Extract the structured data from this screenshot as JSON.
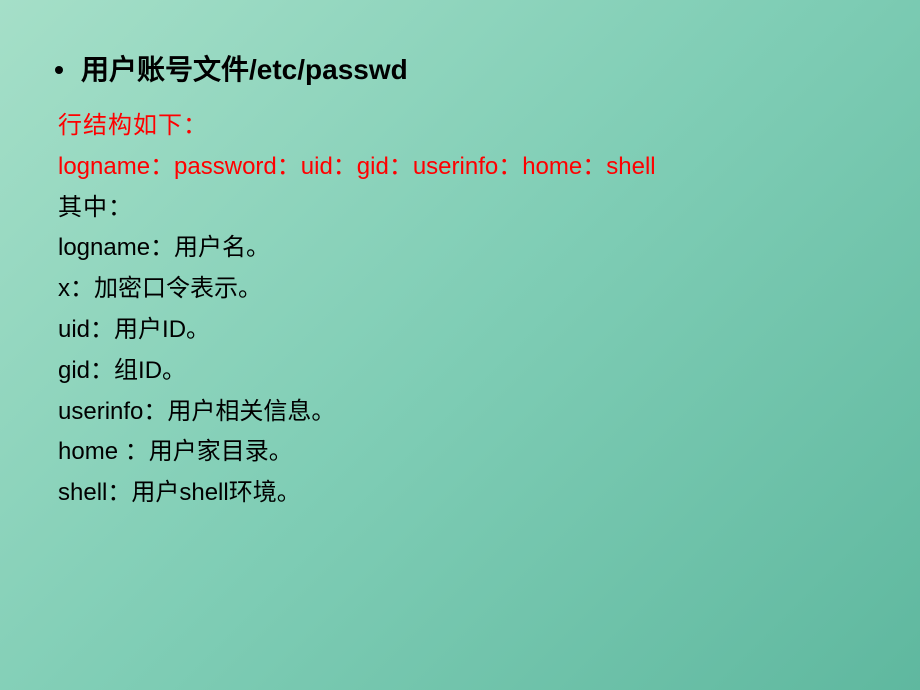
{
  "heading": "用户账号文件/etc/passwd",
  "structure_label": "行结构如下：",
  "format_line": "logname：password：uid：gid：userinfo：home：shell",
  "where_label": "其中：",
  "fields": [
    "logname：用户名。",
    "x：加密口令表示。",
    "uid：用户ID。",
    "gid：组ID。",
    "userinfo：用户相关信息。",
    "home ：用户家目录。",
    "shell：用户shell环境。"
  ]
}
